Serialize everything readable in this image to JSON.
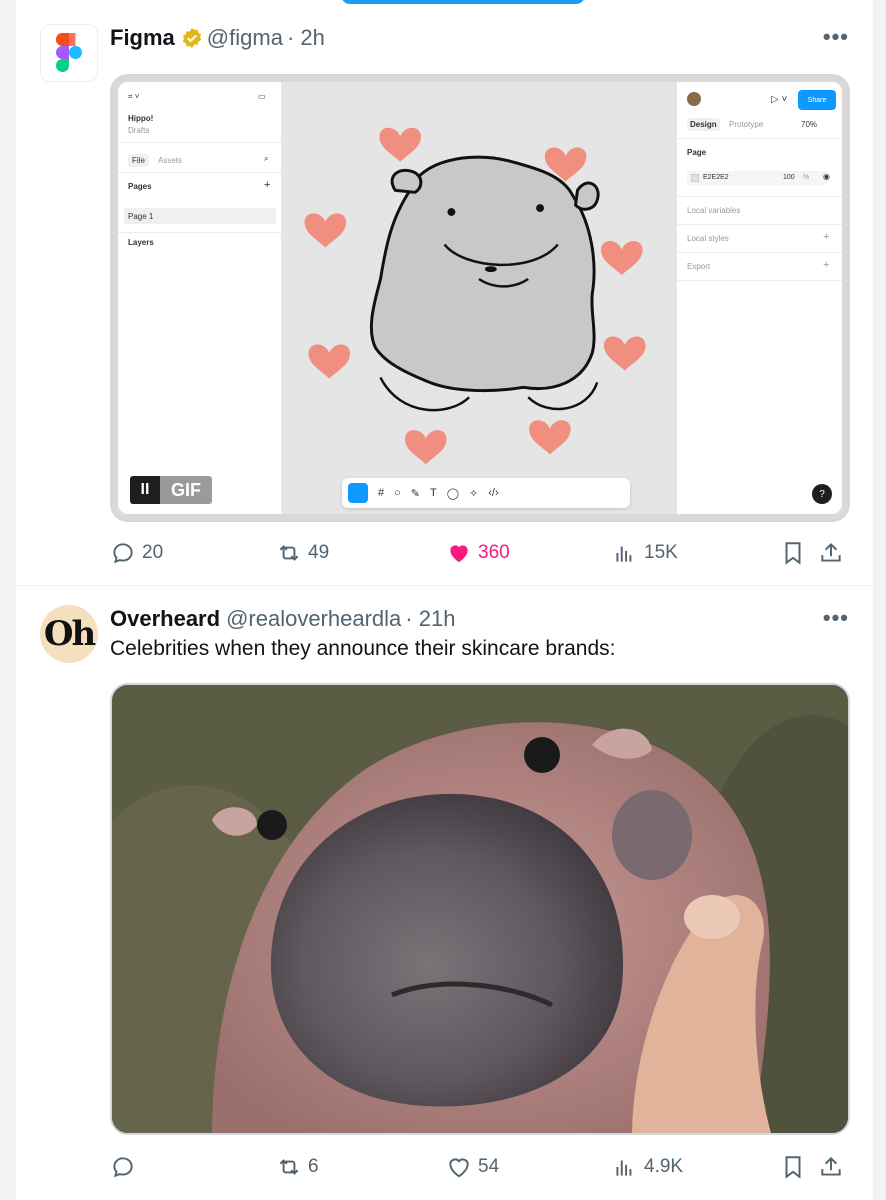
{
  "tweets": [
    {
      "name": "Figma",
      "handle": "@figma",
      "time": "· 2h",
      "text": "",
      "media": {
        "gif_label": "GIF",
        "pause_label": "II",
        "figma": {
          "file_name": "Hippo!",
          "file_sub": "Drafts",
          "tab_file": "File",
          "tab_assets": "Assets",
          "pages_label": "Pages",
          "page_item": "Page 1",
          "layers_label": "Layers",
          "tab_design": "Design",
          "tab_prototype": "Prototype",
          "zoom": "70%",
          "share": "Share",
          "page_section": "Page",
          "fill_hex": "E2E2E2",
          "fill_opacity": "100",
          "fill_pct": "%",
          "local_variables": "Local variables",
          "local_styles": "Local styles",
          "export": "Export",
          "help": "?"
        }
      },
      "stats": {
        "replies": "20",
        "reposts": "49",
        "likes": "360",
        "views": "15K"
      }
    },
    {
      "name": "Overheard",
      "handle": "@realoverheardla",
      "time": "· 21h",
      "avatar_text": "Oh",
      "text": "Celebrities when they announce their skincare brands:",
      "stats": {
        "replies": "",
        "reposts": "6",
        "likes": "54",
        "views": "4.9K"
      }
    }
  ],
  "colors": {
    "like_active": "#f91880",
    "muted": "#536471",
    "verified_gold": "#e2b719",
    "figma_blue": "#0d99ff"
  }
}
